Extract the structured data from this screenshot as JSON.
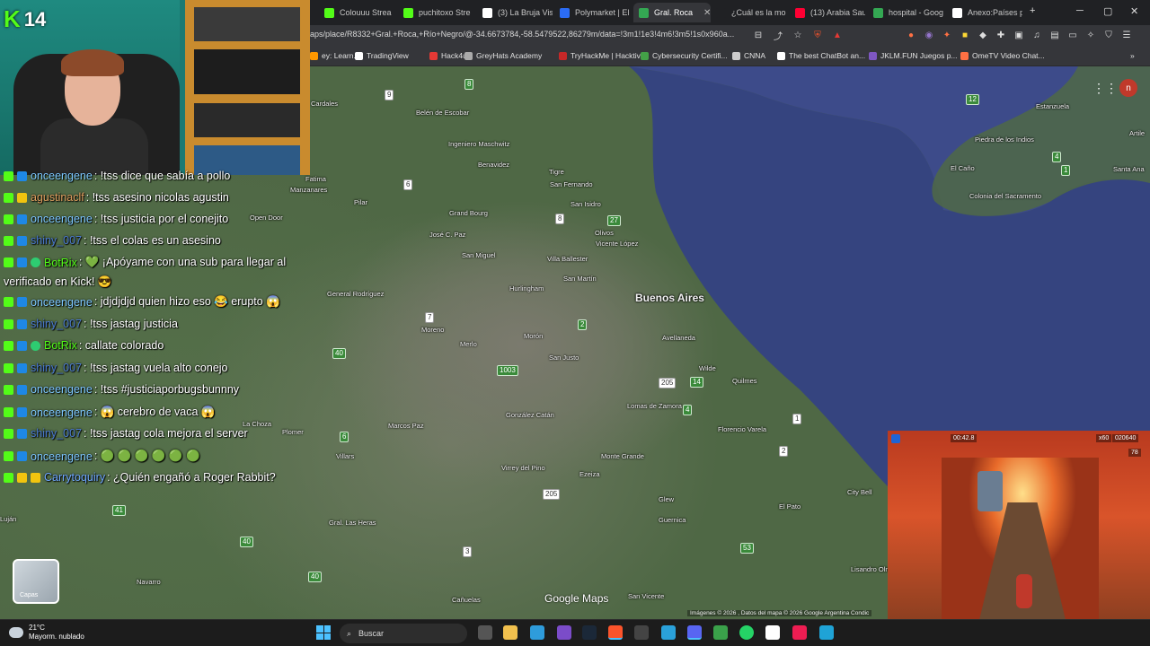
{
  "tabs": [
    {
      "label": "Colouuu Strea",
      "color": "#53fc18"
    },
    {
      "label": "puchitoxo Stre",
      "color": "#53fc18"
    },
    {
      "label": "(3) La Bruja Vis",
      "color": "#ffffff"
    },
    {
      "label": "Polymarket | El",
      "color": "#2b6cf6"
    },
    {
      "label": "Gral. Roca",
      "color": "#34a853",
      "active": true
    },
    {
      "label": "¿Cuál es la mo",
      "color": "#202124"
    },
    {
      "label": "(13) Arabia Sau",
      "color": "#ff0033"
    },
    {
      "label": "hospital - Goog",
      "color": "#34a853"
    },
    {
      "label": "Anexo:Países p",
      "color": "#ffffff"
    }
  ],
  "new_tab_label": "+",
  "window_controls": {
    "minimize": "─",
    "maximize": "▢",
    "close": "✕"
  },
  "address": {
    "url": "aps/place/R8332+Gral.+Roca,+Río+Negro/@-34.6673784,-58.5479522,86279m/data=!3m1!1e3!4m6!3m5!1s0x960a..."
  },
  "bookmarks": [
    {
      "label": "ey: Learn...",
      "color": "#ff9800"
    },
    {
      "label": "TradingView",
      "color": "#ffffff"
    },
    {
      "label": "Hack4u",
      "color": "#e53935"
    },
    {
      "label": "GreyHats Academy",
      "color": "#aaaaaa"
    },
    {
      "label": "TryHackMe | Hacktiv...",
      "color": "#c62828"
    },
    {
      "label": "Cybersecurity Certifi...",
      "color": "#43a047"
    },
    {
      "label": "CNNA",
      "color": "#cccccc"
    },
    {
      "label": "The best ChatBot an...",
      "color": "#ffffff"
    },
    {
      "label": "JKLM.FUN Juegos p...",
      "color": "#7e57c2"
    },
    {
      "label": "OmeTV Video Chat...",
      "color": "#ff7043"
    }
  ],
  "map": {
    "city_label": "Buenos Aires",
    "places": [
      "Cardales",
      "Belén de Escobar",
      "Ingeniero Maschwitz",
      "Benavidez",
      "Tigre",
      "San Fernando",
      "San Isidro",
      "Olivos",
      "Vicente López",
      "Grand Bourg",
      "José C. Paz",
      "San Miguel",
      "Villa Ballester",
      "San Martín",
      "Hurlingham",
      "Pilar",
      "Manzanares",
      "Fatima",
      "Open Door",
      "General Rodríguez",
      "Moreno",
      "Merlo",
      "Morón",
      "San Justo",
      "Avellaneda",
      "Wilde",
      "Quilmes",
      "Lomas de Zamora",
      "González Catán",
      "Marcos Paz",
      "La Choza",
      "Plomer",
      "Villars",
      "Virrey del Pino",
      "Ezeiza",
      "Monte Grande",
      "Florencio Varela",
      "Glew",
      "Guernica",
      "City Bell",
      "El Pato",
      "Gral. Las Heras",
      "Navarro",
      "Cañuelas",
      "San Vicente",
      "Lisandro Olmos",
      "Estanzuela",
      "Piedra de los Indios",
      "El Caño",
      "Colonia del Sacramento",
      "Artile",
      "Santa Ana",
      "Luján"
    ],
    "google_maps_label": "Google Maps",
    "attribution": "Imágenes © 2026 , Datos del mapa © 2026 Google   Argentina   Condic",
    "layers_label": "Capas"
  },
  "stream": {
    "viewer_count": "14"
  },
  "chat": [
    {
      "user": "onceengene",
      "text": ": !tss dice que sabía a pollo",
      "ucls": "u-onc",
      "badges": [
        "b-k",
        "b-s"
      ]
    },
    {
      "user": "agustinaclf",
      "text": ": !tss asesino nicolas agustin",
      "ucls": "u-ag",
      "badges": [
        "b-k",
        "b-y"
      ]
    },
    {
      "user": "onceengene",
      "text": ": !tss justicia por el conejito",
      "ucls": "u-onc",
      "badges": [
        "b-k",
        "b-s"
      ]
    },
    {
      "user": "shiny_007",
      "text": ": !tss el colas es un asesino",
      "ucls": "u-shiny",
      "badges": [
        "b-k",
        "b-s"
      ]
    },
    {
      "user": "BotRix",
      "text": ": 💚 ¡Apóyame con una sub para llegar al",
      "ucls": "u-bot",
      "badges": [
        "b-k",
        "b-s",
        "b-v"
      ]
    },
    {
      "user": "onceengene",
      "text": ": jdjdjdjd quien hizo eso 😂 erupto 😱",
      "ucls": "u-onc",
      "badges": [
        "b-k",
        "b-s"
      ]
    },
    {
      "user": "shiny_007",
      "text": ": !tss jastag justicia",
      "ucls": "u-shiny",
      "badges": [
        "b-k",
        "b-s"
      ]
    },
    {
      "user": "BotRix",
      "text": ": callate colorado",
      "ucls": "u-bot",
      "badges": [
        "b-k",
        "b-s",
        "b-v"
      ]
    },
    {
      "user": "shiny_007",
      "text": ": !tss jastag vuela alto conejo",
      "ucls": "u-shiny",
      "badges": [
        "b-k",
        "b-s"
      ]
    },
    {
      "user": "onceengene",
      "text": ": !tss #justiciaporbugsbunnny",
      "ucls": "u-onc",
      "badges": [
        "b-k",
        "b-s"
      ]
    },
    {
      "user": "onceengene",
      "text": ": 😱 cerebro de vaca 😱",
      "ucls": "u-onc",
      "badges": [
        "b-k",
        "b-s"
      ]
    },
    {
      "user": "shiny_007",
      "text": ": !tss jastag cola mejora el server",
      "ucls": "u-shiny",
      "badges": [
        "b-k",
        "b-s"
      ]
    },
    {
      "user": "onceengene",
      "text": ": 🟢 🟢 🟢 🟢 🟢 🟢",
      "ucls": "u-onc",
      "badges": [
        "b-k",
        "b-s"
      ]
    },
    {
      "user": "Carrytoquiry",
      "text": ": ¿Quién engañó a Roger Rabbit?",
      "ucls": "u-carry",
      "badges": [
        "b-k",
        "b-y",
        "b-y"
      ]
    }
  ],
  "chat_wrap_line": "verificado en Kick! 😎",
  "game": {
    "timer": "00:42.8",
    "score": "020640",
    "multiplier": "x60",
    "coins": "78"
  },
  "taskbar": {
    "weather_temp": "21°C",
    "weather_desc": "Mayorm. nublado",
    "search_label": "Buscar"
  }
}
